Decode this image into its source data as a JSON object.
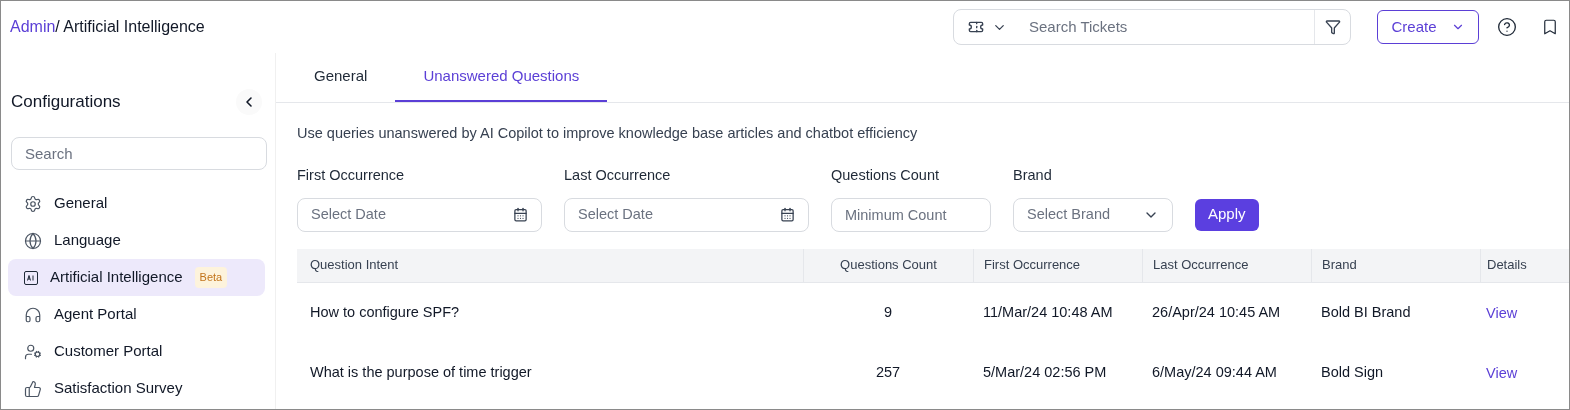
{
  "breadcrumb": {
    "link": "Admin",
    "current": "/ Artificial Intelligence"
  },
  "header": {
    "search": {
      "placeholder": "Search Tickets"
    },
    "create_button": "Create"
  },
  "sidebar": {
    "title": "Configurations",
    "search": {
      "placeholder": "Search"
    },
    "items": [
      {
        "label": "General",
        "selected": false
      },
      {
        "label": "Language",
        "selected": false
      },
      {
        "label": "Artificial Intelligence",
        "selected": true,
        "badge": "Beta"
      },
      {
        "label": "Agent Portal",
        "selected": false
      },
      {
        "label": "Customer Portal",
        "selected": false
      },
      {
        "label": "Satisfaction Survey",
        "selected": false
      }
    ]
  },
  "tabs": [
    {
      "label": "General",
      "selected": false
    },
    {
      "label": "Unanswered Questions",
      "selected": true
    }
  ],
  "description": "Use queries unanswered by AI Copilot to improve knowledge base articles and chatbot efficiency",
  "filters": [
    {
      "kind": "date",
      "label": "First Occurrence",
      "placeholder": "Select Date"
    },
    {
      "kind": "date",
      "label": "Last Occurrence",
      "placeholder": "Select Date"
    },
    {
      "kind": "text",
      "label": "Questions Count",
      "placeholder": "Minimum Count"
    },
    {
      "kind": "select",
      "label": "Brand",
      "placeholder": "Select Brand"
    }
  ],
  "apply_button": "Apply",
  "table": {
    "columns": [
      "Question Intent",
      "Questions Count",
      "First Occurrence",
      "Last Occurrence",
      "Brand",
      "Details"
    ],
    "rows": [
      {
        "cells": [
          "How to configure SPF?",
          "9",
          "11/Mar/24 10:48 AM",
          "26/Apr/24 10:45 AM",
          "Bold BI Brand"
        ],
        "link": "View"
      },
      {
        "cells": [
          "What is the purpose of time trigger",
          "257",
          "5/Mar/24 02:56 PM",
          "6/May/24 09:44 AM",
          "Bold Sign"
        ],
        "link": "View"
      }
    ]
  }
}
